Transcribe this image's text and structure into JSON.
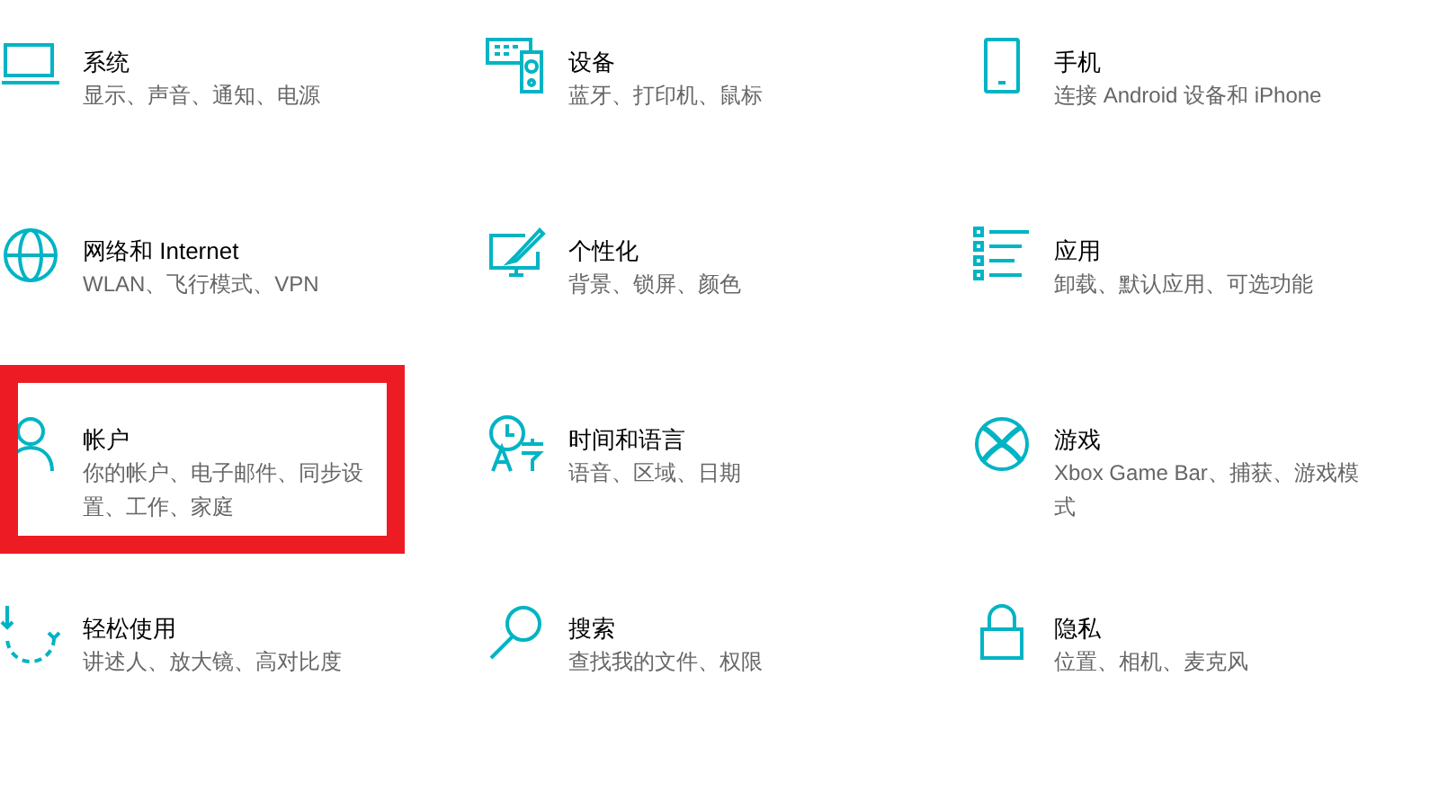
{
  "categories": [
    {
      "kind": "system",
      "title": "系统",
      "description": "显示、声音、通知、电源",
      "highlighted": false
    },
    {
      "kind": "devices",
      "title": "设备",
      "description": "蓝牙、打印机、鼠标",
      "highlighted": false
    },
    {
      "kind": "phone",
      "title": "手机",
      "description": "连接 Android 设备和 iPhone",
      "highlighted": false
    },
    {
      "kind": "network",
      "title": "网络和 Internet",
      "description": "WLAN、飞行模式、VPN",
      "highlighted": false
    },
    {
      "kind": "personalization",
      "title": "个性化",
      "description": "背景、锁屏、颜色",
      "highlighted": false
    },
    {
      "kind": "apps",
      "title": "应用",
      "description": "卸载、默认应用、可选功能",
      "highlighted": false
    },
    {
      "kind": "accounts",
      "title": "帐户",
      "description": "你的帐户、电子邮件、同步设置、工作、家庭",
      "highlighted": true
    },
    {
      "kind": "time",
      "title": "时间和语言",
      "description": "语音、区域、日期",
      "highlighted": false
    },
    {
      "kind": "gaming",
      "title": "游戏",
      "description": "Xbox Game Bar、捕获、游戏模式",
      "highlighted": false
    },
    {
      "kind": "ease",
      "title": "轻松使用",
      "description": "讲述人、放大镜、高对比度",
      "highlighted": false
    },
    {
      "kind": "search",
      "title": "搜索",
      "description": "查找我的文件、权限",
      "highlighted": false
    },
    {
      "kind": "privacy",
      "title": "隐私",
      "description": "位置、相机、麦克风",
      "highlighted": false
    }
  ]
}
